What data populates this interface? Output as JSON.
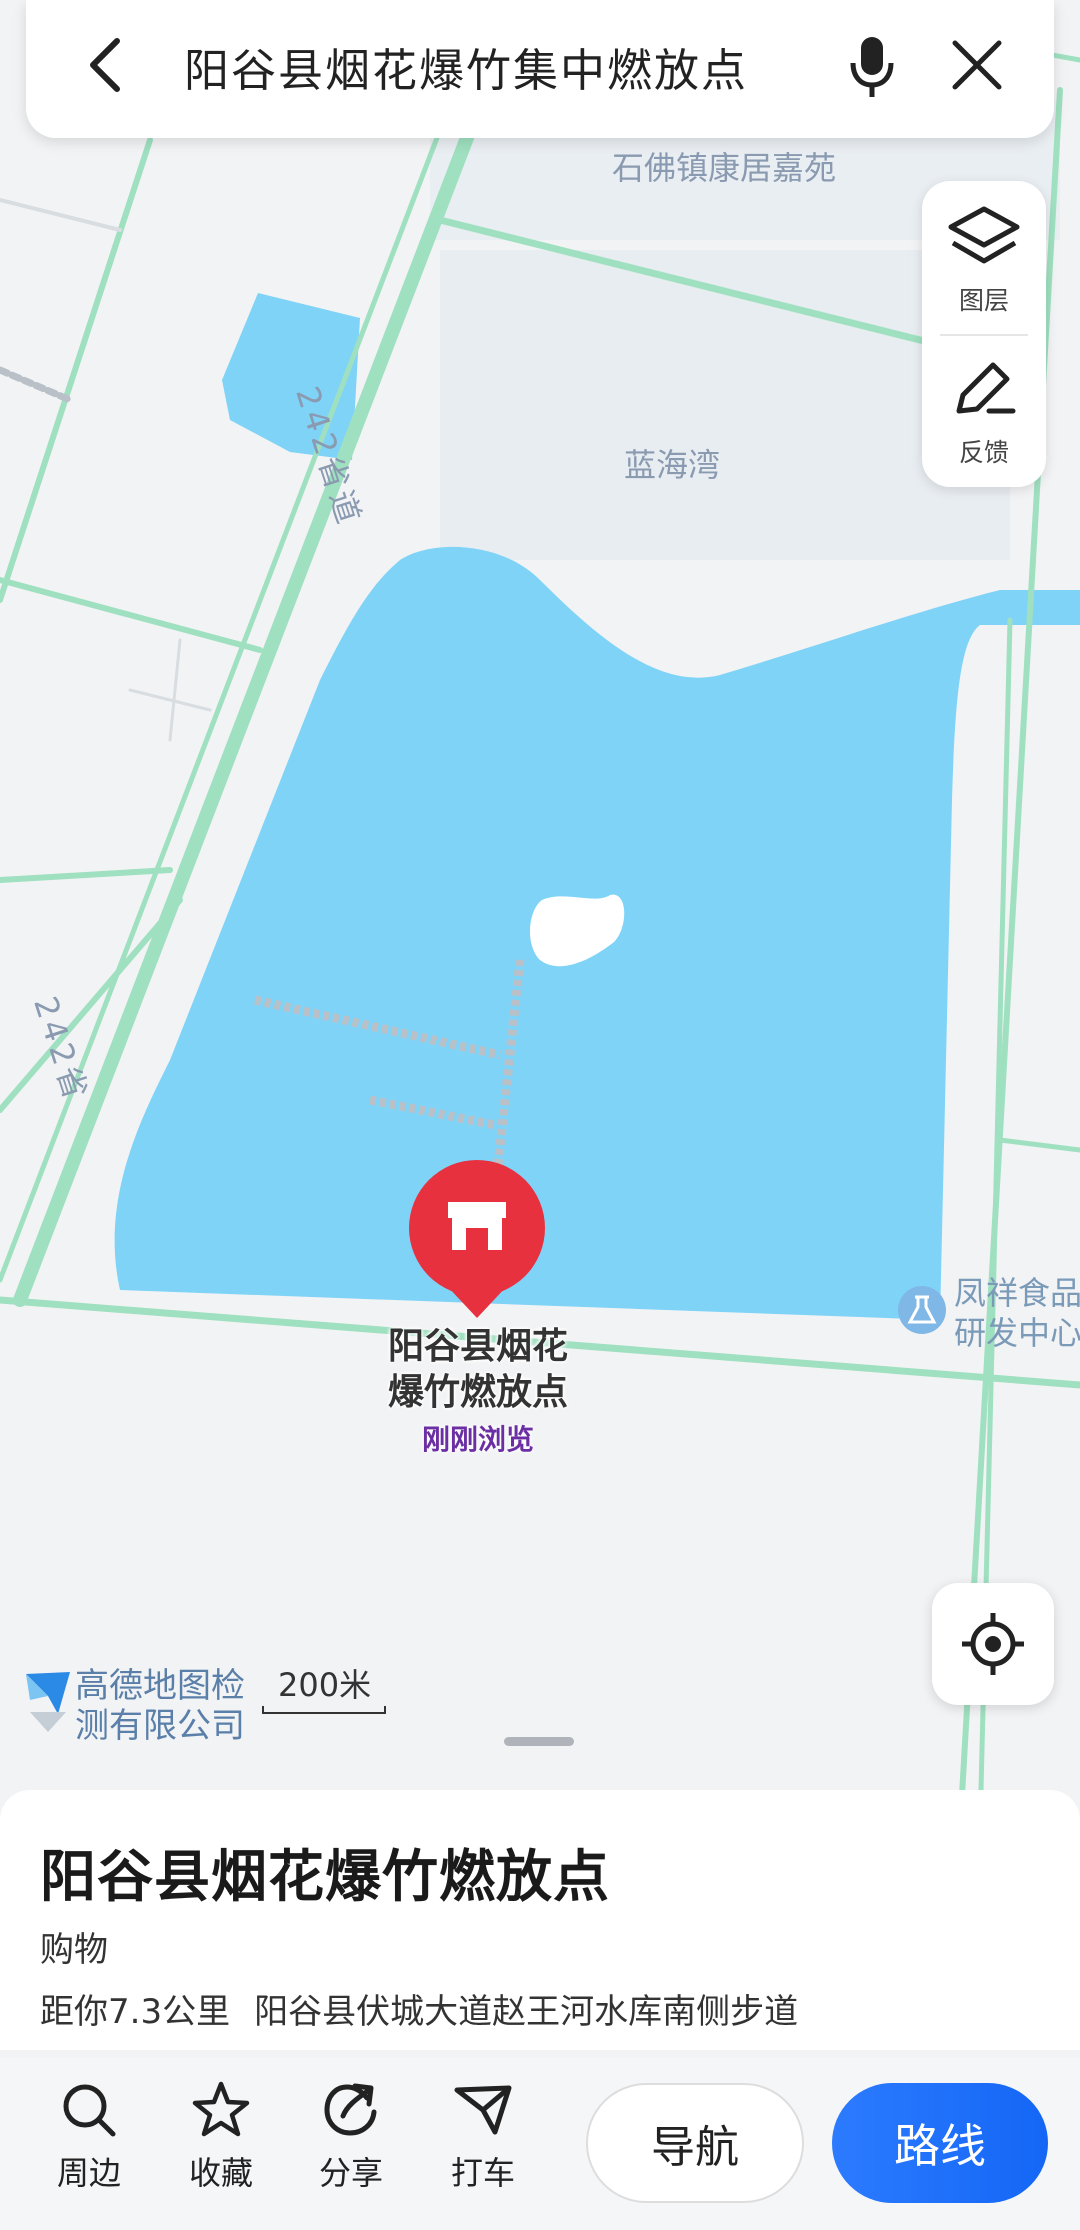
{
  "search": {
    "query": "阳谷县烟花爆竹集中燃放点"
  },
  "side_panel": {
    "layers_label": "图层",
    "feedback_label": "反馈"
  },
  "map": {
    "labels": {
      "residential": "石佛镇康居嘉苑",
      "bay": "蓝海湾",
      "road_top": "242省道",
      "road_bottom": "242省",
      "food_line1": "凤祥食品",
      "food_line2": "研发中心"
    },
    "marker": {
      "name_line1": "阳谷县烟花",
      "name_line2": "爆竹燃放点",
      "status": "刚刚浏览",
      "color": "#e8313f"
    },
    "watermark_line1": "高德地图检",
    "watermark_line2": "测有限公司",
    "scale_label": "200米",
    "colors": {
      "water": "#7fd3f7",
      "road": "#9fe0c0",
      "land": "#f2f3f5"
    }
  },
  "place": {
    "title": "阳谷县烟花爆竹燃放点",
    "category": "购物",
    "distance": "距你7.3公里",
    "address": "阳谷县伏城大道赵王河水库南侧步道"
  },
  "toolbar": {
    "nearby": "周边",
    "favorite": "收藏",
    "share": "分享",
    "taxi": "打车",
    "navigate": "导航",
    "route": "路线",
    "accent": "#1a6ef5"
  }
}
